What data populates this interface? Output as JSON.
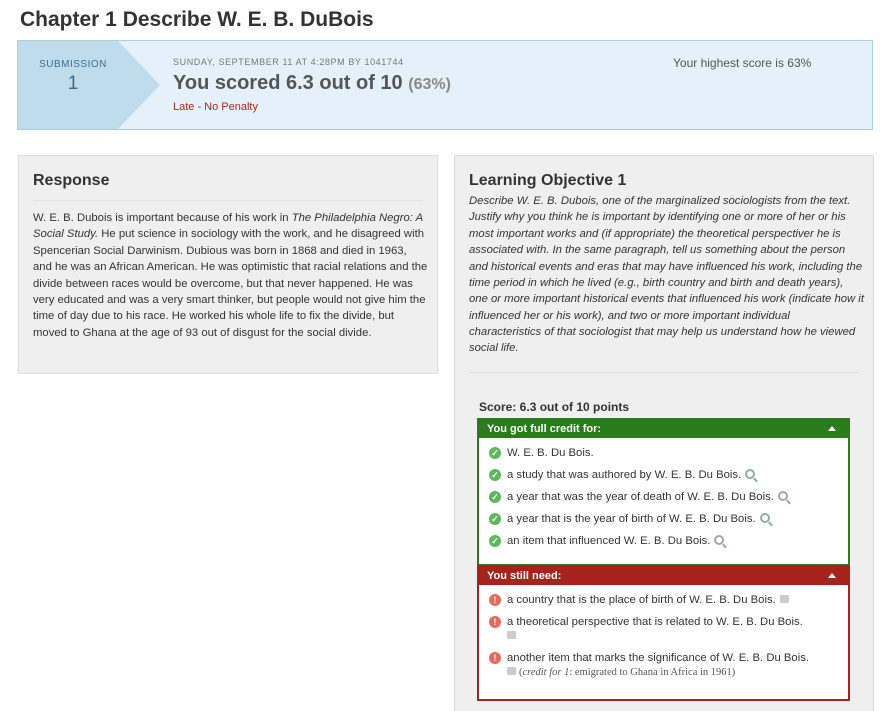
{
  "page": {
    "title": "Chapter 1 Describe W. E. B. DuBois"
  },
  "submission": {
    "label": "SUBMISSION",
    "number": "1",
    "date_line": "SUNDAY, SEPTEMBER 11 AT 4:28PM BY 1041744",
    "score_text": "You scored 6.3 out of 10",
    "score_pct": "(63%)",
    "late": "Late - No Penalty",
    "highest": "Your highest score is 63%"
  },
  "response": {
    "heading": "Response",
    "text_1": "W. E. B. Dubois is important because of his work in ",
    "text_title": "The Philadelphia Negro: A Social Study.",
    "text_2": " He put science in sociology with the work, and he disagreed with Spencerian Social Darwinism. Dubious was born in 1868 and died in 1963, and he was an African American. He was optimistic that racial relations and the divide between races would be overcome, but that never happened. He was very educated and was a very smart thinker, but people would not give him the time of day due to his race. He worked his whole life to fix the divide, but moved to Ghana at the age of 93 out of disgust for the social divide."
  },
  "objective": {
    "heading": "Learning Objective 1",
    "text": "Describe W. E. B. Dubois, one of the marginalized sociologists from the text. Justify why you think he is important by identifying one or more of her or his most important works and (if appropriate) the theoretical perspectiver he is associated with. In the same paragraph, tell us something about the person and historical events and eras that may have influenced his work, including the time period in which he lived (e.g., birth country and birth and death years), one or more important historical events that influenced his work (indicate how it influenced her or his work), and two or more important individual characteristics of that sociologist that may help us understand how he viewed social life.",
    "score_line": "Score: 6.3 out of 10 points"
  },
  "full_credit": {
    "header": "You got full credit for:",
    "items": [
      "W. E. B. Du Bois.",
      "a study that was authored by W. E. B. Du Bois.",
      "a year that was the year of death of W. E. B. Du Bois.",
      "a year that is the year of birth of W. E. B. Du Bois.",
      "an item that influenced W. E. B. Du Bois."
    ]
  },
  "still_need": {
    "header": "You still need:",
    "items": [
      "a country that is the place of birth of W. E. B. Du Bois.",
      "a theoretical perspective that is related to W. E. B. Du Bois.",
      "another item that marks the significance of W. E. B. Du Bois."
    ],
    "note_label": "credit for 1",
    "note_text": ": emigrated to Ghana in Africa in 1961)",
    "note_open": "("
  },
  "colors": {
    "green": "#2b7a1b",
    "red": "#a5231b",
    "banner": "#e4f1f8"
  },
  "icons": {
    "ok": "check-circle-icon",
    "warn": "exclamation-circle-icon",
    "detail": "magnifier-icon",
    "feedback": "thumbs-down-icon"
  }
}
